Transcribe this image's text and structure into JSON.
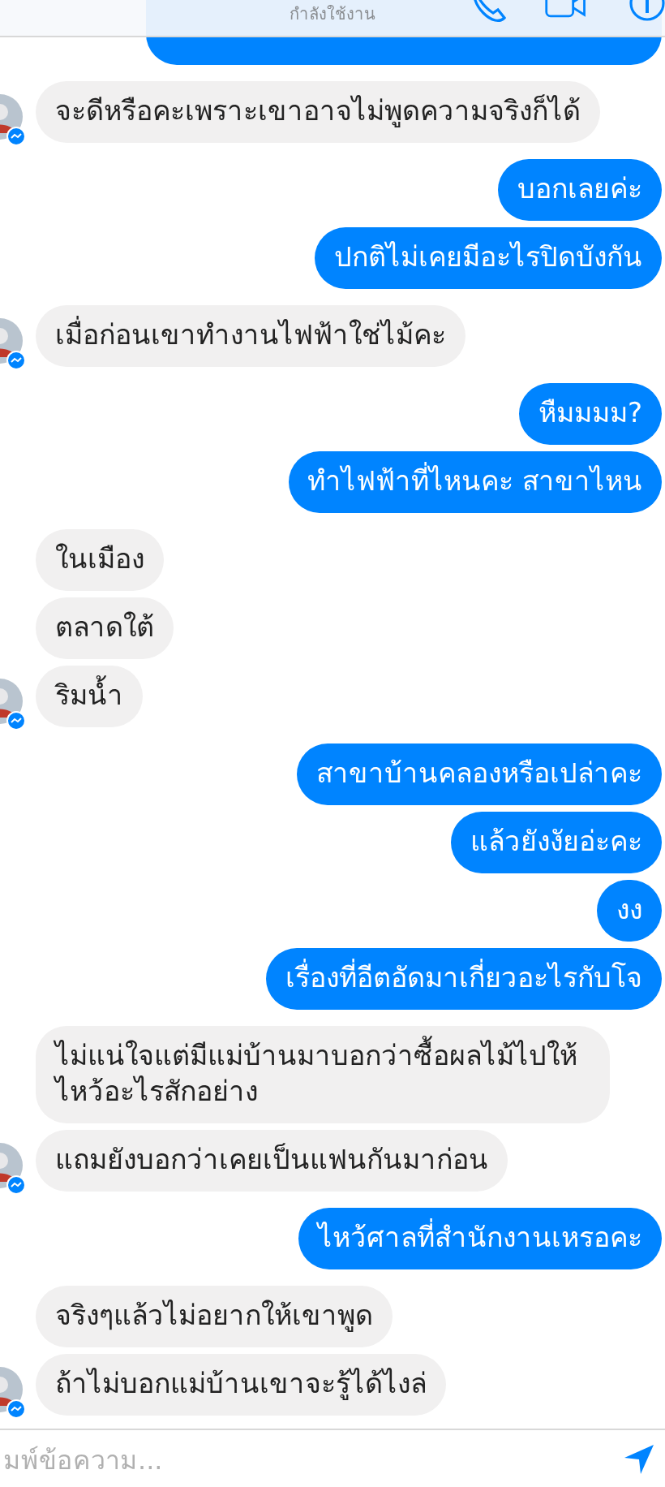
{
  "header": {
    "status": "กำลังใช้งาน"
  },
  "groups": [
    {
      "kind": "cut-off"
    },
    {
      "kind": "received",
      "messages": [
        {
          "text": "จะดีหรือคะเพราะเขาอาจไม่พูดความจริงก็ได้"
        }
      ]
    },
    {
      "kind": "sent",
      "messages": [
        {
          "text": "บอกเลยค่ะ"
        },
        {
          "text": "ปกติไม่เคยมีอะไรปิดบังกัน"
        }
      ]
    },
    {
      "kind": "received",
      "messages": [
        {
          "text": "เมื่อก่อนเขาทำงานไฟฟ้าใช่ไม้คะ"
        }
      ]
    },
    {
      "kind": "sent",
      "messages": [
        {
          "text": "หืมมมม?"
        },
        {
          "text": "ทำไฟฟ้าที่ไหนคะ สาขาไหน"
        }
      ]
    },
    {
      "kind": "received",
      "messages": [
        {
          "text": "ในเมือง"
        },
        {
          "text": "ตลาดใต้"
        },
        {
          "text": "ริมน้ำ"
        }
      ]
    },
    {
      "kind": "sent",
      "messages": [
        {
          "text": "สาขาบ้านคลองหรือเปล่าคะ"
        },
        {
          "text": "แล้วยังงัยอ่ะคะ"
        },
        {
          "text": "งง"
        },
        {
          "text": "เรื่องที่อีตอัดมาเกี่ยวอะไรกับโจ"
        }
      ]
    },
    {
      "kind": "received",
      "messages": [
        {
          "text": "ไม่แน่ใจแต่มีแม่บ้านมาบอกว่าซื้อผลไม้ไปให้ไหว้อะไรสักอย่าง"
        },
        {
          "text": "แถมยังบอกว่าเคยเป็นแฟนกันมาก่อน"
        }
      ]
    },
    {
      "kind": "sent",
      "messages": [
        {
          "text": "ไหว้ศาลที่สำนักงานเหรอคะ"
        }
      ]
    },
    {
      "kind": "received",
      "messages": [
        {
          "text": "จริงๆแล้วไม่อยากให้เขาพูด"
        },
        {
          "text": "ถ้าไม่บอกแม่บ้านเขาจะรู้ได้ไงล่"
        }
      ]
    }
  ],
  "composer": {
    "placeholder": "มพ์ข้อความ..."
  }
}
